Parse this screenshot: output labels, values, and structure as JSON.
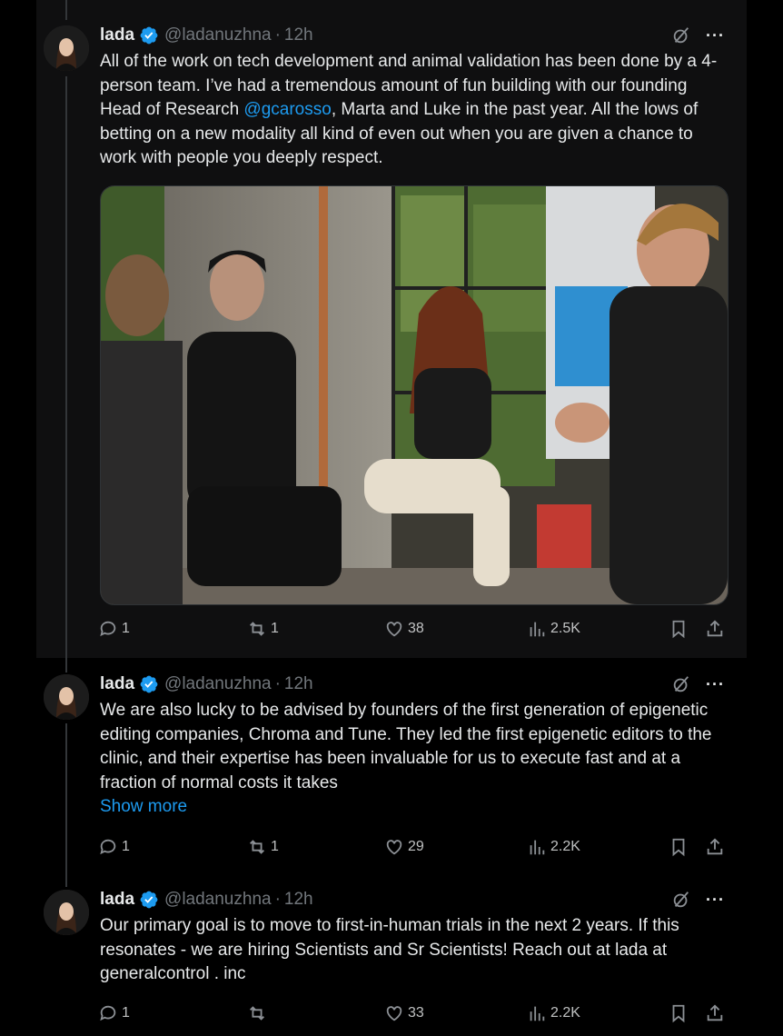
{
  "tweets": [
    {
      "name": "lada",
      "handle": "@ladanuzhna",
      "time": "12h",
      "text_before": "All of the work on tech development and animal validation has been done by a 4-person team. I’ve had a tremendous amount of fun building with our founding Head of Research ",
      "mention": "@gcarosso",
      "text_after": ", Marta and Luke in the past year. All the lows of betting on a new modality all kind of even out when you are given a chance to work with people you deeply respect.",
      "replies": "1",
      "reposts": "1",
      "likes": "38",
      "views": "2.5K"
    },
    {
      "name": "lada",
      "handle": "@ladanuzhna",
      "time": "12h",
      "text": "We are also lucky to be advised by founders of the first generation of epigenetic editing companies, Chroma and Tune. They led the first epigenetic editors to the clinic, and their expertise has been invaluable for us to execute fast and at a fraction of normal costs it takes",
      "show_more": "Show more",
      "replies": "1",
      "reposts": "1",
      "likes": "29",
      "views": "2.2K"
    },
    {
      "name": "lada",
      "handle": "@ladanuzhna",
      "time": "12h",
      "text": "Our primary goal is to move to first-in-human trials in the next 2 years. If this resonates - we are hiring Scientists and Sr Scientists! Reach out at lada at generalcontrol . inc",
      "replies": "1",
      "reposts": "",
      "likes": "33",
      "views": "2.2K"
    }
  ],
  "colors": {
    "accent": "#1d9bf0",
    "muted": "#71767b",
    "text": "#e7e9ea",
    "background": "#000000"
  },
  "icons": [
    "verified-badge-icon",
    "grok-icon",
    "more-icon",
    "reply-icon",
    "repost-icon",
    "like-icon",
    "views-icon",
    "bookmark-icon",
    "share-icon"
  ]
}
